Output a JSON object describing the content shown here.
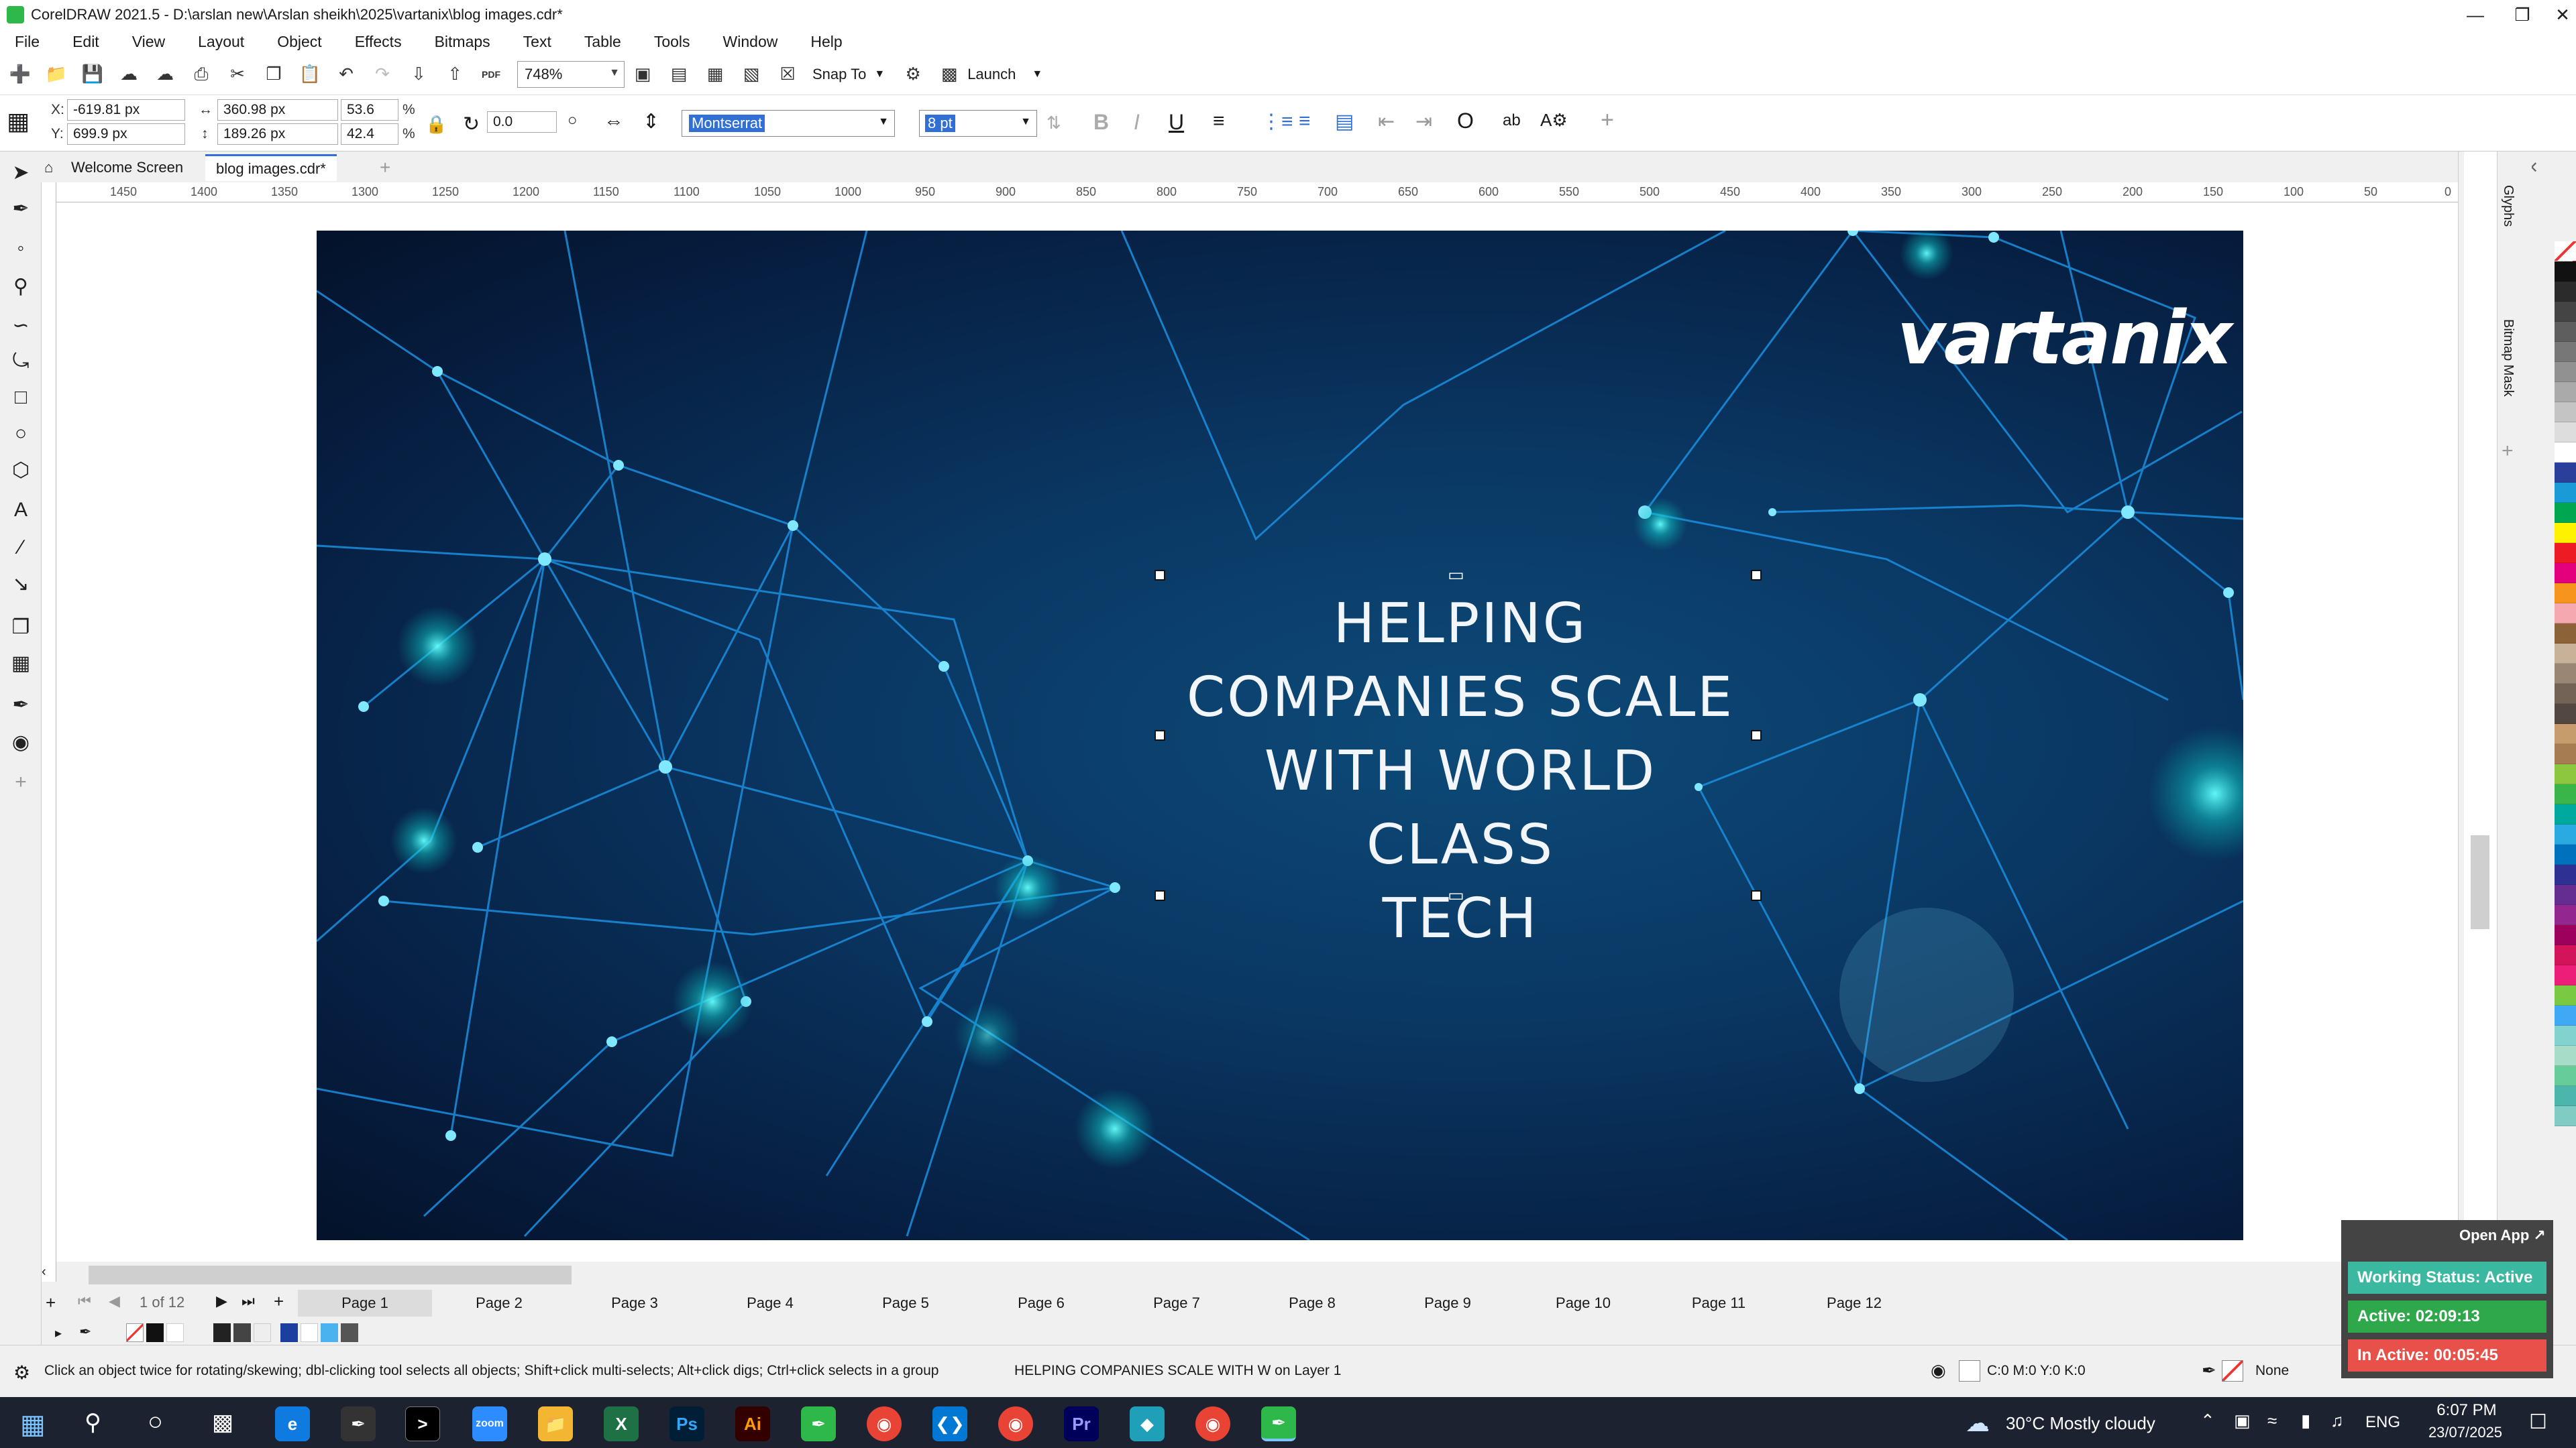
{
  "window": {
    "title": "CorelDRAW 2021.5 - D:\\arslan new\\Arslan sheikh\\2025\\vartanix\\blog images.cdr*"
  },
  "menu": [
    "File",
    "Edit",
    "View",
    "Layout",
    "Object",
    "Effects",
    "Bitmaps",
    "Text",
    "Table",
    "Tools",
    "Window",
    "Help"
  ],
  "toolbar": {
    "zoom": "748%",
    "snap_to": "Snap To",
    "launch": "Launch",
    "pdf_label": "PDF"
  },
  "props": {
    "x_label": "X:",
    "x": "-619.81 px",
    "y_label": "Y:",
    "y": "699.9 px",
    "w": "360.98 px",
    "h": "189.26 px",
    "sx": "53.6",
    "sy": "42.4",
    "pct": "%",
    "rotation": "0.0",
    "font": "Montserrat",
    "size": "8 pt"
  },
  "tabs": {
    "welcome": "Welcome Screen",
    "doc": "blog images.cdr*",
    "add": "+"
  },
  "ruler": {
    "ticks": [
      "1450",
      "1400",
      "1350",
      "1300",
      "1250",
      "1200",
      "1150",
      "1100",
      "1050",
      "1000",
      "950",
      "900",
      "850",
      "800",
      "750",
      "700",
      "650",
      "600",
      "550",
      "500",
      "450",
      "400",
      "350",
      "300",
      "250",
      "200",
      "150",
      "100",
      "50",
      "0"
    ],
    "unit": "pixels"
  },
  "artwork": {
    "headline": "HELPING COMPANIES SCALE WITH WORLD CLASS TECH",
    "headline_lines": [
      "HELPING",
      "COMPANIES SCALE",
      "WITH WORLD CLASS",
      "TECH"
    ],
    "logo": "vartanix"
  },
  "dockers": {
    "glyphs": "Glyphs",
    "bitmap_mask": "Bitmap Mask"
  },
  "pages": {
    "counter": "1 of 12",
    "tabs": [
      "Page 1",
      "Page 2",
      "Page 3",
      "Page 4",
      "Page 5",
      "Page 6",
      "Page 7",
      "Page 8",
      "Page 9",
      "Page 10",
      "Page 11",
      "Page 12"
    ]
  },
  "status": {
    "hint": "Click an object twice for rotating/skewing; dbl-clicking tool selects all objects; Shift+click multi-selects; Alt+click digs; Ctrl+click selects in a group",
    "selection": "HELPING COMPANIES SCALE WITH W on Layer 1",
    "fill": "C:0 M:0 Y:0 K:0",
    "outline": "None"
  },
  "tracker": {
    "open_app": "Open App ↗",
    "working": "Working Status: Active",
    "active": "Active: 02:09:13",
    "inactive": "In Active: 00:05:45"
  },
  "taskbar": {
    "weather": "30°C  Mostly cloudy",
    "lang": "ENG",
    "time": "6:07 PM",
    "date": "23/07/2025",
    "ps": "Ps",
    "ai": "Ai",
    "pr": "Pr"
  },
  "colors": {
    "accent": "#2eb84a",
    "working": "#3bb8a0",
    "active": "#2ea84a",
    "inactive": "#e8504a"
  }
}
